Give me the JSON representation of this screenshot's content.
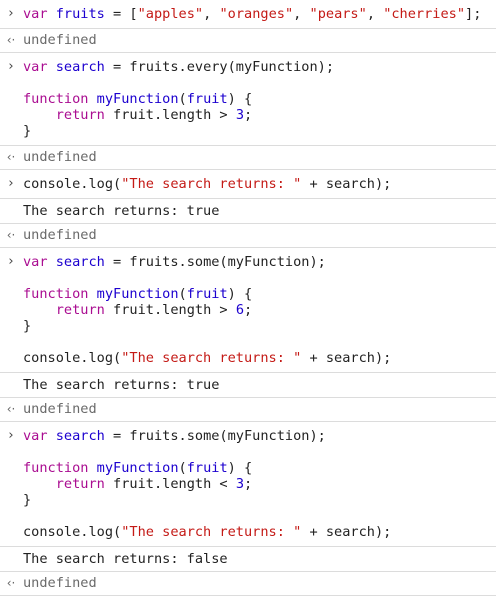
{
  "prompts": {
    "input": "›",
    "result": "‹·"
  },
  "entries": [
    {
      "type": "input",
      "lines": [
        [
          {
            "t": "kw",
            "v": "var"
          },
          {
            "t": "plain",
            "v": " "
          },
          {
            "t": "ident",
            "v": "fruits"
          },
          {
            "t": "plain",
            "v": " = ["
          },
          {
            "t": "str",
            "v": "\"apples\""
          },
          {
            "t": "plain",
            "v": ", "
          },
          {
            "t": "str",
            "v": "\"oranges\""
          },
          {
            "t": "plain",
            "v": ", "
          },
          {
            "t": "str",
            "v": "\"pears\""
          },
          {
            "t": "plain",
            "v": ", "
          },
          {
            "t": "str",
            "v": "\"cherries\""
          },
          {
            "t": "plain",
            "v": "];"
          }
        ]
      ]
    },
    {
      "type": "result",
      "text": "undefined"
    },
    {
      "type": "input",
      "lines": [
        [
          {
            "t": "kw",
            "v": "var"
          },
          {
            "t": "plain",
            "v": " "
          },
          {
            "t": "ident",
            "v": "search"
          },
          {
            "t": "plain",
            "v": " = fruits.every(myFunction);"
          }
        ],
        [],
        [
          {
            "t": "kw",
            "v": "function"
          },
          {
            "t": "plain",
            "v": " "
          },
          {
            "t": "fn",
            "v": "myFunction"
          },
          {
            "t": "plain",
            "v": "("
          },
          {
            "t": "ident",
            "v": "fruit"
          },
          {
            "t": "plain",
            "v": ") {"
          }
        ],
        [
          {
            "t": "plain",
            "v": "    "
          },
          {
            "t": "kw",
            "v": "return"
          },
          {
            "t": "plain",
            "v": " fruit.length > "
          },
          {
            "t": "num",
            "v": "3"
          },
          {
            "t": "plain",
            "v": ";"
          }
        ],
        [
          {
            "t": "plain",
            "v": "}"
          }
        ]
      ]
    },
    {
      "type": "result",
      "text": "undefined"
    },
    {
      "type": "input",
      "lines": [
        [
          {
            "t": "plain",
            "v": "console.log("
          },
          {
            "t": "str",
            "v": "\"The search returns: \""
          },
          {
            "t": "plain",
            "v": " + search);"
          }
        ]
      ]
    },
    {
      "type": "log",
      "text": "The search returns: true"
    },
    {
      "type": "result",
      "text": "undefined"
    },
    {
      "type": "input",
      "lines": [
        [
          {
            "t": "kw",
            "v": "var"
          },
          {
            "t": "plain",
            "v": " "
          },
          {
            "t": "ident",
            "v": "search"
          },
          {
            "t": "plain",
            "v": " = fruits.some(myFunction);"
          }
        ],
        [],
        [
          {
            "t": "kw",
            "v": "function"
          },
          {
            "t": "plain",
            "v": " "
          },
          {
            "t": "fn",
            "v": "myFunction"
          },
          {
            "t": "plain",
            "v": "("
          },
          {
            "t": "ident",
            "v": "fruit"
          },
          {
            "t": "plain",
            "v": ") {"
          }
        ],
        [
          {
            "t": "plain",
            "v": "    "
          },
          {
            "t": "kw",
            "v": "return"
          },
          {
            "t": "plain",
            "v": " fruit.length > "
          },
          {
            "t": "num",
            "v": "6"
          },
          {
            "t": "plain",
            "v": ";"
          }
        ],
        [
          {
            "t": "plain",
            "v": "}"
          }
        ],
        [],
        [
          {
            "t": "plain",
            "v": "console.log("
          },
          {
            "t": "str",
            "v": "\"The search returns: \""
          },
          {
            "t": "plain",
            "v": " + search);"
          }
        ]
      ]
    },
    {
      "type": "log",
      "text": "The search returns: true"
    },
    {
      "type": "result",
      "text": "undefined"
    },
    {
      "type": "input",
      "lines": [
        [
          {
            "t": "kw",
            "v": "var"
          },
          {
            "t": "plain",
            "v": " "
          },
          {
            "t": "ident",
            "v": "search"
          },
          {
            "t": "plain",
            "v": " = fruits.some(myFunction);"
          }
        ],
        [],
        [
          {
            "t": "kw",
            "v": "function"
          },
          {
            "t": "plain",
            "v": " "
          },
          {
            "t": "fn",
            "v": "myFunction"
          },
          {
            "t": "plain",
            "v": "("
          },
          {
            "t": "ident",
            "v": "fruit"
          },
          {
            "t": "plain",
            "v": ") {"
          }
        ],
        [
          {
            "t": "plain",
            "v": "    "
          },
          {
            "t": "kw",
            "v": "return"
          },
          {
            "t": "plain",
            "v": " fruit.length < "
          },
          {
            "t": "num",
            "v": "3"
          },
          {
            "t": "plain",
            "v": ";"
          }
        ],
        [
          {
            "t": "plain",
            "v": "}"
          }
        ],
        [],
        [
          {
            "t": "plain",
            "v": "console.log("
          },
          {
            "t": "str",
            "v": "\"The search returns: \""
          },
          {
            "t": "plain",
            "v": " + search);"
          }
        ]
      ]
    },
    {
      "type": "log",
      "text": "The search returns: false"
    },
    {
      "type": "result",
      "text": "undefined"
    }
  ],
  "colors": {
    "keyword": "#aa0d91",
    "identifier": "#1c00cf",
    "string": "#c41a16",
    "number": "#1c00cf",
    "result": "#6a6a6a",
    "separator": "#dcdcdc"
  }
}
